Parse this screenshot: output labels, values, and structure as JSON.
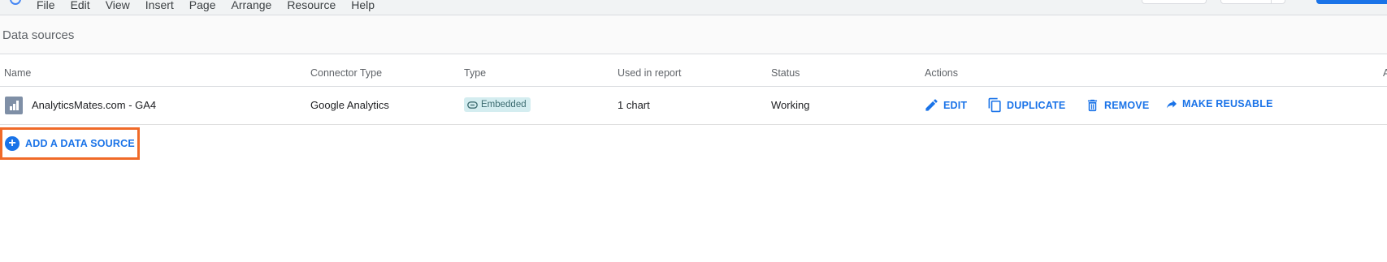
{
  "menu": {
    "items": [
      "File",
      "Edit",
      "View",
      "Insert",
      "Page",
      "Arrange",
      "Resource",
      "Help"
    ]
  },
  "panel": {
    "title": "Data sources"
  },
  "table": {
    "headers": {
      "name": "Name",
      "connector": "Connector Type",
      "type": "Type",
      "used": "Used in report",
      "status": "Status",
      "actions": "Actions",
      "end": "A"
    },
    "rows": [
      {
        "name": "AnalyticsMates.com - GA4",
        "connector": "Google Analytics",
        "type": "Embedded",
        "used": "1 chart",
        "status": "Working"
      }
    ],
    "actions": {
      "edit": "EDIT",
      "duplicate": "DUPLICATE",
      "remove": "REMOVE",
      "make_reusable": "MAKE REUSABLE"
    }
  },
  "add_source": {
    "label": "ADD A DATA SOURCE"
  },
  "icons": {
    "data_source": "bar-chart-icon",
    "chip": "link-icon",
    "edit": "pencil-icon",
    "duplicate": "copy-icon",
    "remove": "trash-icon",
    "make_reusable": "share-arrow-icon",
    "add": "plus-circle-icon"
  },
  "colors": {
    "accent": "#1a73e8",
    "highlight_border": "#f06a28",
    "chip_bg": "#d4edf0"
  }
}
